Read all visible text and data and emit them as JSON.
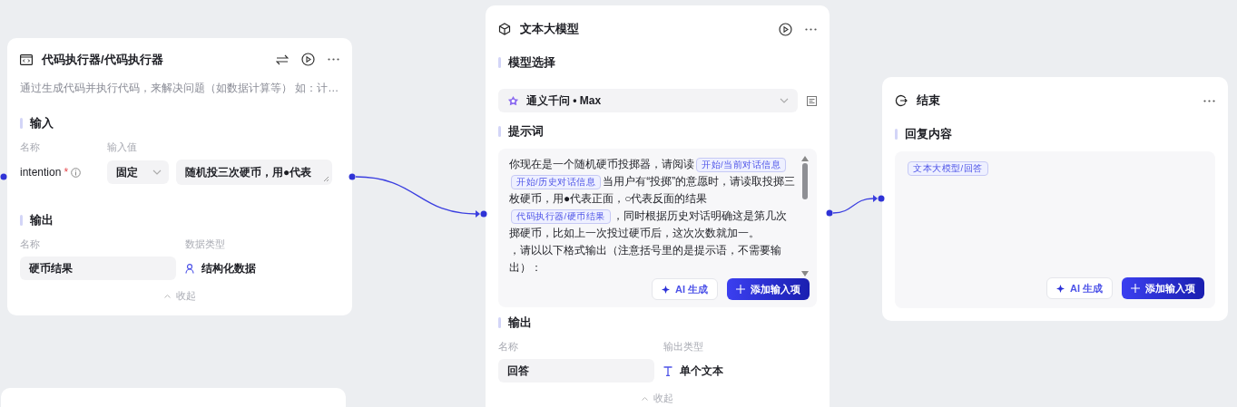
{
  "nodes": [
    {
      "kind": "code",
      "title": "代码执行器/代码执行器",
      "description": "通过生成代码并执行代码，来解决问题（如数据计算等） 如：计…",
      "input": {
        "heading": "输入",
        "columns": [
          "名称",
          "输入值"
        ],
        "rows": [
          {
            "name": "intention",
            "required_mark": "*",
            "mode": "固定",
            "value": "随机投三次硬币，用●代表"
          }
        ]
      },
      "output": {
        "heading": "输出",
        "columns": [
          "名称",
          "数据类型"
        ],
        "rows": [
          {
            "name": "硬币结果",
            "type": "结构化数据"
          }
        ]
      },
      "collapse": "收起"
    },
    {
      "kind": "llm",
      "title": "文本大模型",
      "model_heading": "模型选择",
      "model": "通义千问 • Max",
      "prompt_heading": "提示词",
      "prompt": [
        {
          "kind": "text",
          "text": "你现在是一个随机硬币投掷器，请阅读"
        },
        {
          "kind": "tag",
          "text": "开始/当前对话信息"
        },
        {
          "kind": "tag",
          "text": "开始/历史对话信息"
        },
        {
          "kind": "text",
          "text": "当用户有“投掷”的意愿时，请读取投掷三枚硬币，用●代表正面，○代表反面的结果"
        },
        {
          "kind": "tag",
          "text": "代码执行器/硬币结果"
        },
        {
          "kind": "text",
          "text": "，同时根据历史对话明确这是第几次掷硬币，比如上一次投过硬币后，这次次数就加一。"
        },
        {
          "kind": "break"
        },
        {
          "kind": "text",
          "text": "，请以以下格式输出（注意括号里的是提示语，不需要输出）："
        }
      ],
      "buttons": [
        {
          "kind": "ai",
          "label": "AI 生成"
        },
        {
          "kind": "add",
          "label": "添加输入项"
        }
      ],
      "output": {
        "heading": "输出",
        "columns": [
          "名称",
          "输出类型"
        ],
        "rows": [
          {
            "name": "回答",
            "type": "单个文本"
          }
        ]
      },
      "collapse": "收起"
    },
    {
      "kind": "end",
      "title": "结束",
      "heading": "回复内容",
      "content": [
        {
          "kind": "tag",
          "text": "文本大模型/回答"
        }
      ],
      "buttons": [
        {
          "kind": "ai",
          "label": "AI 生成"
        },
        {
          "kind": "add",
          "label": "添加输入项"
        }
      ]
    },
    {
      "kind": "llm_collapsed"
    }
  ]
}
